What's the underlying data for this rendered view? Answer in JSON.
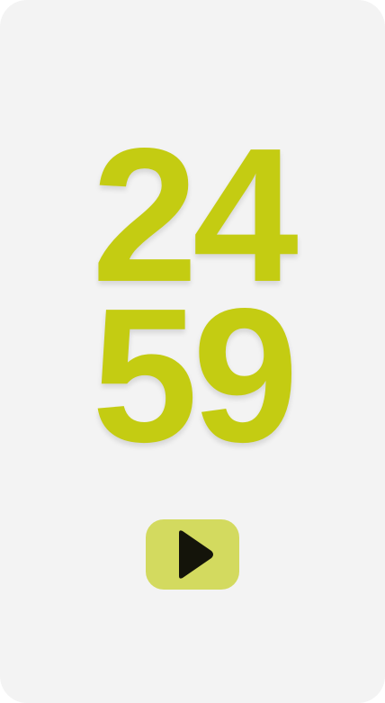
{
  "timer": {
    "hours": "24",
    "minutes": "59"
  },
  "controls": {
    "play_icon": "play-icon"
  },
  "colors": {
    "background": "#f3f3f3",
    "digits": "#c4cc12",
    "play_button": "#d3da5f",
    "play_icon": "#14140a"
  }
}
